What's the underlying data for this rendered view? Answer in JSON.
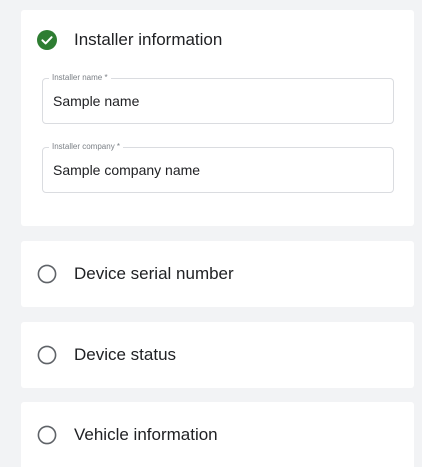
{
  "steps": [
    {
      "title": "Installer information",
      "status": "completed",
      "fields": [
        {
          "label": "Installer name *",
          "value": "Sample name"
        },
        {
          "label": "Installer company *",
          "value": "Sample company name"
        }
      ]
    },
    {
      "title": "Device serial number",
      "status": "pending"
    },
    {
      "title": "Device status",
      "status": "pending"
    },
    {
      "title": "Vehicle information",
      "status": "pending"
    }
  ],
  "colors": {
    "completed": "#2e7d32",
    "pending_ring": "#5f6368",
    "field_border": "#dadce0",
    "background": "#f2f3f5"
  },
  "icons": {
    "completed": "check-circle-icon",
    "pending": "radio-circle-icon"
  }
}
